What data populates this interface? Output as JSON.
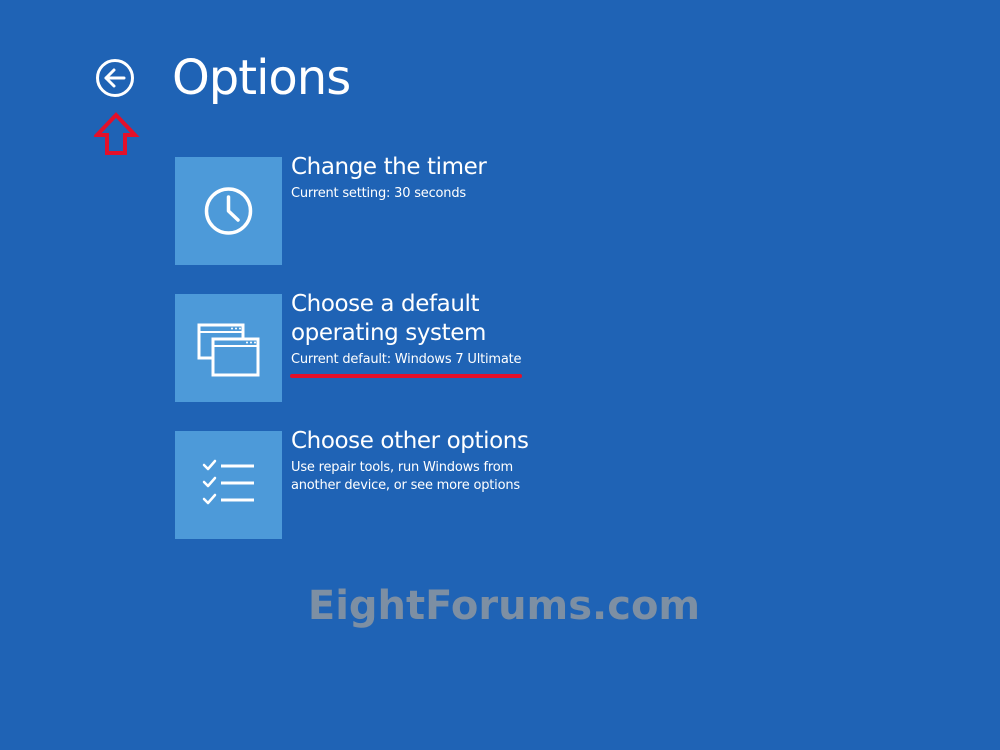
{
  "header": {
    "title": "Options",
    "back_icon": "back-arrow-circle-icon"
  },
  "annotation": {
    "icon": "red-up-arrow-icon",
    "color": "#e3102a"
  },
  "options": [
    {
      "title": "Change the timer",
      "subtitle_lines": [
        "Current setting: 30 seconds"
      ],
      "icon": "clock-icon"
    },
    {
      "title_lines": [
        "Choose a default",
        "operating system"
      ],
      "subtitle_lines": [
        "Current default: Windows 7 Ultimate"
      ],
      "icon": "windows-stack-icon"
    },
    {
      "title": "Choose other options",
      "subtitle_lines": [
        "Use repair tools, run Windows from",
        "another device, or see more options"
      ],
      "icon": "checklist-icon"
    }
  ],
  "watermark": {
    "text": "EightForums.com"
  },
  "colors": {
    "background": "#1f63b5",
    "tile": "#4d9ad9",
    "text": "#ffffff",
    "highlight_underline": "#e3102a",
    "watermark": "#7d8fa3"
  }
}
